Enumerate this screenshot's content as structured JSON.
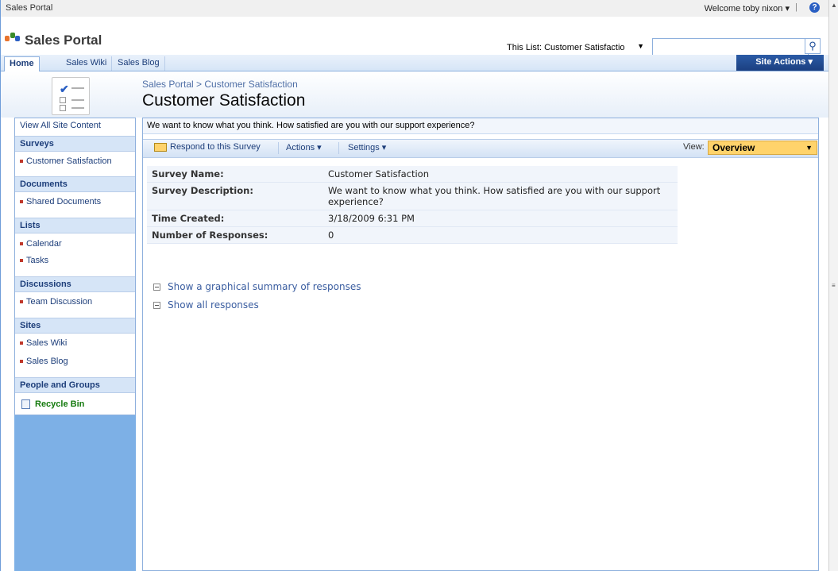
{
  "topbar": {
    "site_name": "Sales Portal",
    "welcome": "Welcome toby nixon ▾",
    "separator": "|"
  },
  "header": {
    "title": "Sales Portal"
  },
  "search": {
    "scope": "This List: Customer Satisfactio",
    "placeholder": ""
  },
  "nav": {
    "tabs": [
      {
        "label": "Home"
      },
      {
        "label": "Sales Wiki"
      },
      {
        "label": "Sales Blog"
      }
    ],
    "site_actions": "Site Actions ▾"
  },
  "breadcrumb": {
    "root": "Sales Portal",
    "sep": " > ",
    "current": "Customer Satisfaction"
  },
  "page_title": "Customer Satisfaction",
  "quicklaunch": {
    "view_all": "View All Site Content",
    "surveys": {
      "title": "Surveys",
      "items": [
        "Customer Satisfaction"
      ]
    },
    "documents": {
      "title": "Documents",
      "items": [
        "Shared Documents"
      ]
    },
    "lists": {
      "title": "Lists",
      "items": [
        "Calendar",
        "Tasks"
      ]
    },
    "discussions": {
      "title": "Discussions",
      "items": [
        "Team Discussion"
      ]
    },
    "sites": {
      "title": "Sites",
      "items": [
        "Sales Wiki",
        "Sales Blog"
      ]
    },
    "people": {
      "title": "People and Groups"
    },
    "recycle": "Recycle Bin"
  },
  "main": {
    "description": "We want to know what you think. How satisfied are you with our support experience?",
    "toolbar": {
      "respond": "Respond to this Survey",
      "actions": "Actions ▾",
      "settings": "Settings ▾",
      "view_label": "View:",
      "view_value": "Overview"
    },
    "details": [
      {
        "key": "Survey Name:",
        "value": "Customer Satisfaction"
      },
      {
        "key": "Survey Description:",
        "value": "We want to know what you think. How satisfied are you with our support experience?"
      },
      {
        "key": "Time Created:",
        "value": "3/18/2009 6:31 PM"
      },
      {
        "key": "Number of Responses:",
        "value": "0"
      }
    ],
    "links": {
      "graphical": "Show a graphical summary of responses",
      "all": "Show all responses"
    }
  },
  "colors": {
    "nav_accent": "#1b3f80",
    "quicklaunch_bg": "#7db0e6",
    "recycle": "#13790c",
    "view_select": "#ffd36b"
  }
}
